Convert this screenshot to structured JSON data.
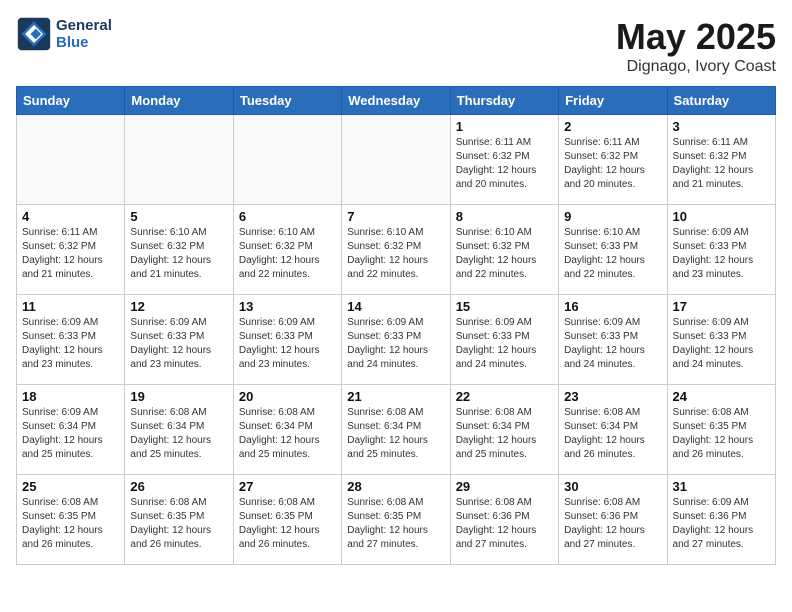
{
  "header": {
    "logo_line1": "General",
    "logo_line2": "Blue",
    "month": "May 2025",
    "location": "Dignago, Ivory Coast"
  },
  "weekdays": [
    "Sunday",
    "Monday",
    "Tuesday",
    "Wednesday",
    "Thursday",
    "Friday",
    "Saturday"
  ],
  "weeks": [
    [
      {
        "day": "",
        "info": ""
      },
      {
        "day": "",
        "info": ""
      },
      {
        "day": "",
        "info": ""
      },
      {
        "day": "",
        "info": ""
      },
      {
        "day": "1",
        "info": "Sunrise: 6:11 AM\nSunset: 6:32 PM\nDaylight: 12 hours\nand 20 minutes."
      },
      {
        "day": "2",
        "info": "Sunrise: 6:11 AM\nSunset: 6:32 PM\nDaylight: 12 hours\nand 20 minutes."
      },
      {
        "day": "3",
        "info": "Sunrise: 6:11 AM\nSunset: 6:32 PM\nDaylight: 12 hours\nand 21 minutes."
      }
    ],
    [
      {
        "day": "4",
        "info": "Sunrise: 6:11 AM\nSunset: 6:32 PM\nDaylight: 12 hours\nand 21 minutes."
      },
      {
        "day": "5",
        "info": "Sunrise: 6:10 AM\nSunset: 6:32 PM\nDaylight: 12 hours\nand 21 minutes."
      },
      {
        "day": "6",
        "info": "Sunrise: 6:10 AM\nSunset: 6:32 PM\nDaylight: 12 hours\nand 22 minutes."
      },
      {
        "day": "7",
        "info": "Sunrise: 6:10 AM\nSunset: 6:32 PM\nDaylight: 12 hours\nand 22 minutes."
      },
      {
        "day": "8",
        "info": "Sunrise: 6:10 AM\nSunset: 6:32 PM\nDaylight: 12 hours\nand 22 minutes."
      },
      {
        "day": "9",
        "info": "Sunrise: 6:10 AM\nSunset: 6:33 PM\nDaylight: 12 hours\nand 22 minutes."
      },
      {
        "day": "10",
        "info": "Sunrise: 6:09 AM\nSunset: 6:33 PM\nDaylight: 12 hours\nand 23 minutes."
      }
    ],
    [
      {
        "day": "11",
        "info": "Sunrise: 6:09 AM\nSunset: 6:33 PM\nDaylight: 12 hours\nand 23 minutes."
      },
      {
        "day": "12",
        "info": "Sunrise: 6:09 AM\nSunset: 6:33 PM\nDaylight: 12 hours\nand 23 minutes."
      },
      {
        "day": "13",
        "info": "Sunrise: 6:09 AM\nSunset: 6:33 PM\nDaylight: 12 hours\nand 23 minutes."
      },
      {
        "day": "14",
        "info": "Sunrise: 6:09 AM\nSunset: 6:33 PM\nDaylight: 12 hours\nand 24 minutes."
      },
      {
        "day": "15",
        "info": "Sunrise: 6:09 AM\nSunset: 6:33 PM\nDaylight: 12 hours\nand 24 minutes."
      },
      {
        "day": "16",
        "info": "Sunrise: 6:09 AM\nSunset: 6:33 PM\nDaylight: 12 hours\nand 24 minutes."
      },
      {
        "day": "17",
        "info": "Sunrise: 6:09 AM\nSunset: 6:33 PM\nDaylight: 12 hours\nand 24 minutes."
      }
    ],
    [
      {
        "day": "18",
        "info": "Sunrise: 6:09 AM\nSunset: 6:34 PM\nDaylight: 12 hours\nand 25 minutes."
      },
      {
        "day": "19",
        "info": "Sunrise: 6:08 AM\nSunset: 6:34 PM\nDaylight: 12 hours\nand 25 minutes."
      },
      {
        "day": "20",
        "info": "Sunrise: 6:08 AM\nSunset: 6:34 PM\nDaylight: 12 hours\nand 25 minutes."
      },
      {
        "day": "21",
        "info": "Sunrise: 6:08 AM\nSunset: 6:34 PM\nDaylight: 12 hours\nand 25 minutes."
      },
      {
        "day": "22",
        "info": "Sunrise: 6:08 AM\nSunset: 6:34 PM\nDaylight: 12 hours\nand 25 minutes."
      },
      {
        "day": "23",
        "info": "Sunrise: 6:08 AM\nSunset: 6:34 PM\nDaylight: 12 hours\nand 26 minutes."
      },
      {
        "day": "24",
        "info": "Sunrise: 6:08 AM\nSunset: 6:35 PM\nDaylight: 12 hours\nand 26 minutes."
      }
    ],
    [
      {
        "day": "25",
        "info": "Sunrise: 6:08 AM\nSunset: 6:35 PM\nDaylight: 12 hours\nand 26 minutes."
      },
      {
        "day": "26",
        "info": "Sunrise: 6:08 AM\nSunset: 6:35 PM\nDaylight: 12 hours\nand 26 minutes."
      },
      {
        "day": "27",
        "info": "Sunrise: 6:08 AM\nSunset: 6:35 PM\nDaylight: 12 hours\nand 26 minutes."
      },
      {
        "day": "28",
        "info": "Sunrise: 6:08 AM\nSunset: 6:35 PM\nDaylight: 12 hours\nand 27 minutes."
      },
      {
        "day": "29",
        "info": "Sunrise: 6:08 AM\nSunset: 6:36 PM\nDaylight: 12 hours\nand 27 minutes."
      },
      {
        "day": "30",
        "info": "Sunrise: 6:08 AM\nSunset: 6:36 PM\nDaylight: 12 hours\nand 27 minutes."
      },
      {
        "day": "31",
        "info": "Sunrise: 6:09 AM\nSunset: 6:36 PM\nDaylight: 12 hours\nand 27 minutes."
      }
    ]
  ]
}
